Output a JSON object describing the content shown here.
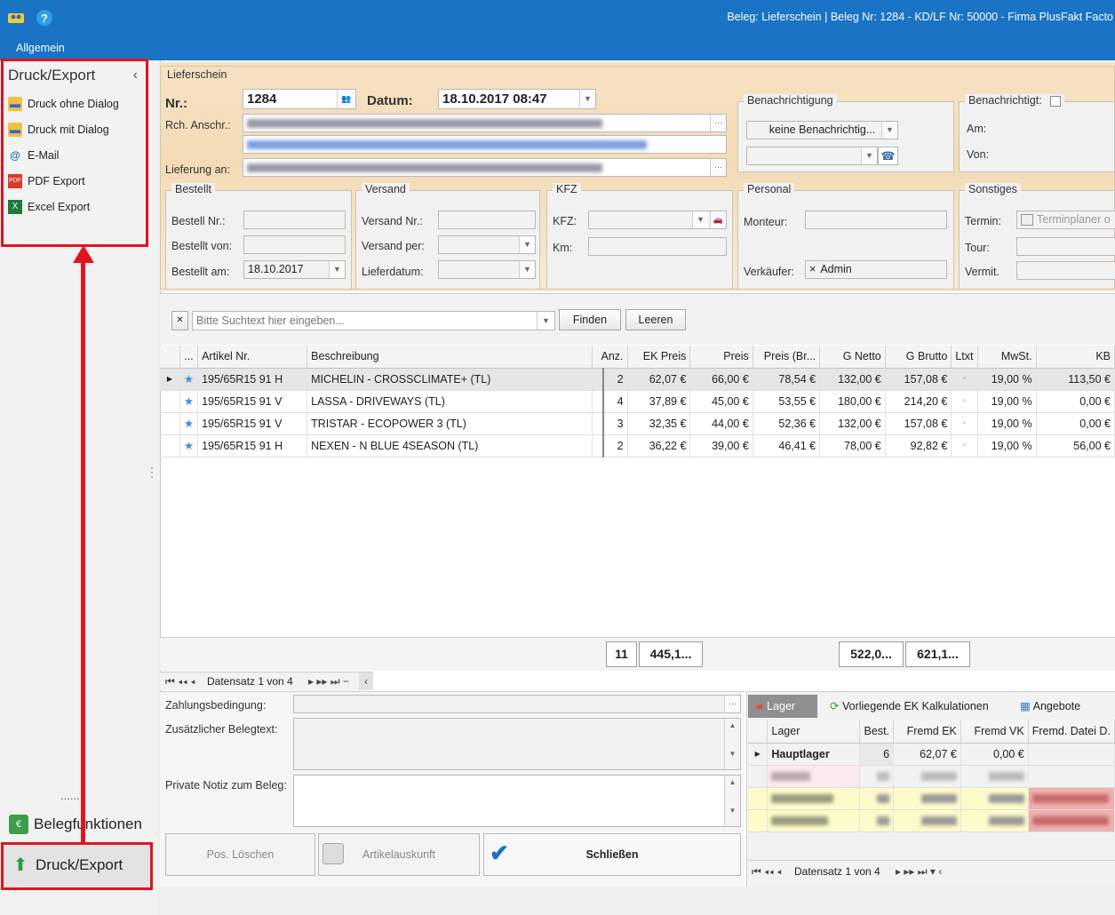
{
  "titlebar": {
    "title": "Beleg: Lieferschein | Beleg Nr: 1284 -  KD/LF Nr: 50000 - Firma PlusFakt Facto",
    "menu": "Allgemein",
    "icons": [
      "users-icon",
      "help-icon"
    ]
  },
  "sidebar": {
    "panel_title": "Druck/Export",
    "collapse_glyph": "‹",
    "items": [
      {
        "label": "Druck ohne Dialog",
        "icon": "printer-icon"
      },
      {
        "label": "Druck mit Dialog",
        "icon": "printer-icon"
      },
      {
        "label": "E-Mail",
        "icon": "at-icon"
      },
      {
        "label": "PDF Export",
        "icon": "pdf-icon"
      },
      {
        "label": "Excel Export",
        "icon": "excel-icon"
      }
    ],
    "dots": "......",
    "nav": [
      {
        "label": "Belegfunktionen",
        "icon": "money-icon"
      },
      {
        "label": "Druck/Export",
        "icon": "upload-arrow-icon"
      }
    ]
  },
  "header": {
    "section": "Lieferschein",
    "nr_label": "Nr.:",
    "nr_value": "1284",
    "datum_label": "Datum:",
    "datum_value": "18.10.2017 08:47",
    "rch_label": "Rch. Anschr.:",
    "lieferung_label": "Lieferung an:",
    "benachrichtigung": {
      "title": "Benachrichtigung",
      "select": "keine Benachrichtig...",
      "checkbox_label": "Benachrichtigt:",
      "am": "Am:",
      "von": "Von:"
    },
    "bestellt": {
      "title": "Bestellt",
      "nr": "Bestell Nr.:",
      "von": "Bestellt von:",
      "am": "Bestellt am:",
      "am_value": "18.10.2017"
    },
    "versand": {
      "title": "Versand",
      "nr": "Versand Nr.:",
      "per": "Versand per:",
      "datum": "Lieferdatum:"
    },
    "kfz": {
      "title": "KFZ",
      "kfz": "KFZ:",
      "km": "Km:"
    },
    "personal": {
      "title": "Personal",
      "monteur": "Monteur:",
      "verkaeufer": "Verkäufer:",
      "verkaeufer_value": "Admin"
    },
    "sonstiges": {
      "title": "Sonstiges",
      "termin": "Termin:",
      "terminplaner": "Terminplaner o",
      "tour": "Tour:",
      "vermit": "Vermit."
    }
  },
  "search": {
    "placeholder": "Bitte Suchtext hier eingeben...",
    "find": "Finden",
    "clear": "Leeren",
    "clear_x": "✕"
  },
  "grid": {
    "columns": [
      "...",
      "Artikel Nr.",
      "Beschreibung",
      "Anz.",
      "EK Preis",
      "Preis",
      "Preis (Br...",
      "G Netto",
      "G Brutto",
      "Ltxt",
      "MwSt.",
      "KB"
    ],
    "rows": [
      {
        "artnr": "195/65R15 91 H",
        "desc": "MICHELIN - CROSSCLIMATE+ (TL)",
        "anz": "2",
        "ek": "62,07 €",
        "preis": "66,00 €",
        "preis_br": "78,54 €",
        "netto": "132,00 €",
        "brutto": "157,08 €",
        "mwst": "19,00 %",
        "kb": "113,50 €"
      },
      {
        "artnr": "195/65R15 91 V",
        "desc": "LASSA - DRIVEWAYS (TL)",
        "anz": "4",
        "ek": "37,89 €",
        "preis": "45,00 €",
        "preis_br": "53,55 €",
        "netto": "180,00 €",
        "brutto": "214,20 €",
        "mwst": "19,00 %",
        "kb": "0,00 €"
      },
      {
        "artnr": "195/65R15 91 V",
        "desc": "TRISTAR - ECOPOWER 3 (TL)",
        "anz": "3",
        "ek": "32,35 €",
        "preis": "44,00 €",
        "preis_br": "52,36 €",
        "netto": "132,00 €",
        "brutto": "157,08 €",
        "mwst": "19,00 %",
        "kb": "0,00 €"
      },
      {
        "artnr": "195/65R15 91 H",
        "desc": "NEXEN - N BLUE 4SEASON (TL)",
        "anz": "2",
        "ek": "36,22 €",
        "preis": "39,00 €",
        "preis_br": "46,41 €",
        "netto": "78,00 €",
        "brutto": "92,82 €",
        "mwst": "19,00 %",
        "kb": "56,00 €"
      }
    ],
    "totals": {
      "anz": "11",
      "ek": "445,1...",
      "netto": "522,0...",
      "brutto": "621,1..."
    },
    "nav": "Datensatz 1 von 4"
  },
  "bottom": {
    "zahlung": "Zahlungsbedingung:",
    "zusatz": "Zusätzlicher Belegtext:",
    "notiz": "Private Notiz zum Beleg:",
    "btn_delete": "Pos. Löschen",
    "btn_info": "Artikelauskunft",
    "btn_close": "Schließen"
  },
  "lager": {
    "tabs": [
      "Lager",
      "Vorliegende EK Kalkulationen",
      "Angebote"
    ],
    "columns": [
      "Lager",
      "Best.",
      "Fremd EK",
      "Fremd VK",
      "Fremd. Datei D."
    ],
    "row": {
      "name": "Hauptlager",
      "best": "6",
      "ek": "62,07 €",
      "vk": "0,00 €"
    },
    "nav": "Datensatz 1 von 4"
  },
  "colors": {
    "title_blue": "#1a73c4",
    "highlight_red": "#e0141e",
    "header_orange": "#f3dbb6"
  }
}
